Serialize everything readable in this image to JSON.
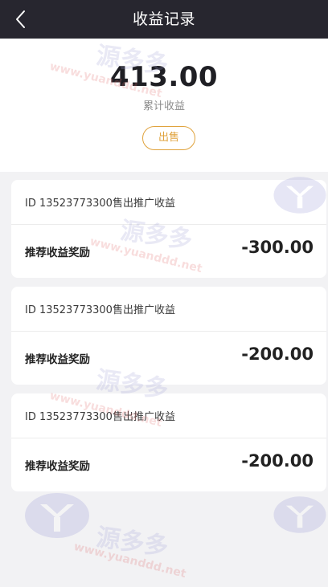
{
  "header": {
    "title": "收益记录",
    "back_icon": "back-arrow-icon"
  },
  "summary": {
    "total_amount": "413.00",
    "total_label": "累计收益",
    "sell_label": "出售"
  },
  "records": [
    {
      "description": "ID 13523773300售出推广收益",
      "type": "推荐收益奖励",
      "amount": "-300.00"
    },
    {
      "description": "ID 13523773300售出推广收益",
      "type": "推荐收益奖励",
      "amount": "-200.00"
    },
    {
      "description": "ID 13523773300售出推广收益",
      "type": "推荐收益奖励",
      "amount": "-200.00"
    }
  ],
  "watermark": {
    "text": "源多多",
    "url": "www.yuanddd.net"
  },
  "colors": {
    "header_bg": "#27262f",
    "accent": "#e0a33d",
    "page_bg": "#f2f2f4"
  }
}
